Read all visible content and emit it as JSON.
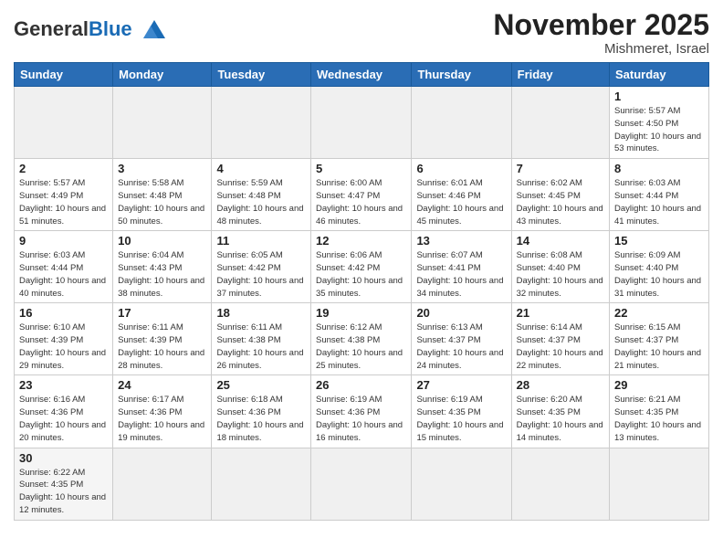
{
  "logo": {
    "text_general": "General",
    "text_blue": "Blue"
  },
  "header": {
    "month_title": "November 2025",
    "subtitle": "Mishmeret, Israel"
  },
  "weekdays": [
    "Sunday",
    "Monday",
    "Tuesday",
    "Wednesday",
    "Thursday",
    "Friday",
    "Saturday"
  ],
  "weeks": [
    [
      {
        "day": "",
        "empty": true
      },
      {
        "day": "",
        "empty": true
      },
      {
        "day": "",
        "empty": true
      },
      {
        "day": "",
        "empty": true
      },
      {
        "day": "",
        "empty": true
      },
      {
        "day": "",
        "empty": true
      },
      {
        "day": "1",
        "sunrise": "5:57 AM",
        "sunset": "4:50 PM",
        "daylight": "10 hours and 53 minutes."
      }
    ],
    [
      {
        "day": "2",
        "sunrise": "5:57 AM",
        "sunset": "4:49 PM",
        "daylight": "10 hours and 51 minutes."
      },
      {
        "day": "3",
        "sunrise": "5:58 AM",
        "sunset": "4:48 PM",
        "daylight": "10 hours and 50 minutes."
      },
      {
        "day": "4",
        "sunrise": "5:59 AM",
        "sunset": "4:48 PM",
        "daylight": "10 hours and 48 minutes."
      },
      {
        "day": "5",
        "sunrise": "6:00 AM",
        "sunset": "4:47 PM",
        "daylight": "10 hours and 46 minutes."
      },
      {
        "day": "6",
        "sunrise": "6:01 AM",
        "sunset": "4:46 PM",
        "daylight": "10 hours and 45 minutes."
      },
      {
        "day": "7",
        "sunrise": "6:02 AM",
        "sunset": "4:45 PM",
        "daylight": "10 hours and 43 minutes."
      },
      {
        "day": "8",
        "sunrise": "6:03 AM",
        "sunset": "4:44 PM",
        "daylight": "10 hours and 41 minutes."
      }
    ],
    [
      {
        "day": "9",
        "sunrise": "6:03 AM",
        "sunset": "4:44 PM",
        "daylight": "10 hours and 40 minutes."
      },
      {
        "day": "10",
        "sunrise": "6:04 AM",
        "sunset": "4:43 PM",
        "daylight": "10 hours and 38 minutes."
      },
      {
        "day": "11",
        "sunrise": "6:05 AM",
        "sunset": "4:42 PM",
        "daylight": "10 hours and 37 minutes."
      },
      {
        "day": "12",
        "sunrise": "6:06 AM",
        "sunset": "4:42 PM",
        "daylight": "10 hours and 35 minutes."
      },
      {
        "day": "13",
        "sunrise": "6:07 AM",
        "sunset": "4:41 PM",
        "daylight": "10 hours and 34 minutes."
      },
      {
        "day": "14",
        "sunrise": "6:08 AM",
        "sunset": "4:40 PM",
        "daylight": "10 hours and 32 minutes."
      },
      {
        "day": "15",
        "sunrise": "6:09 AM",
        "sunset": "4:40 PM",
        "daylight": "10 hours and 31 minutes."
      }
    ],
    [
      {
        "day": "16",
        "sunrise": "6:10 AM",
        "sunset": "4:39 PM",
        "daylight": "10 hours and 29 minutes."
      },
      {
        "day": "17",
        "sunrise": "6:11 AM",
        "sunset": "4:39 PM",
        "daylight": "10 hours and 28 minutes."
      },
      {
        "day": "18",
        "sunrise": "6:11 AM",
        "sunset": "4:38 PM",
        "daylight": "10 hours and 26 minutes."
      },
      {
        "day": "19",
        "sunrise": "6:12 AM",
        "sunset": "4:38 PM",
        "daylight": "10 hours and 25 minutes."
      },
      {
        "day": "20",
        "sunrise": "6:13 AM",
        "sunset": "4:37 PM",
        "daylight": "10 hours and 24 minutes."
      },
      {
        "day": "21",
        "sunrise": "6:14 AM",
        "sunset": "4:37 PM",
        "daylight": "10 hours and 22 minutes."
      },
      {
        "day": "22",
        "sunrise": "6:15 AM",
        "sunset": "4:37 PM",
        "daylight": "10 hours and 21 minutes."
      }
    ],
    [
      {
        "day": "23",
        "sunrise": "6:16 AM",
        "sunset": "4:36 PM",
        "daylight": "10 hours and 20 minutes."
      },
      {
        "day": "24",
        "sunrise": "6:17 AM",
        "sunset": "4:36 PM",
        "daylight": "10 hours and 19 minutes."
      },
      {
        "day": "25",
        "sunrise": "6:18 AM",
        "sunset": "4:36 PM",
        "daylight": "10 hours and 18 minutes."
      },
      {
        "day": "26",
        "sunrise": "6:19 AM",
        "sunset": "4:36 PM",
        "daylight": "10 hours and 16 minutes."
      },
      {
        "day": "27",
        "sunrise": "6:19 AM",
        "sunset": "4:35 PM",
        "daylight": "10 hours and 15 minutes."
      },
      {
        "day": "28",
        "sunrise": "6:20 AM",
        "sunset": "4:35 PM",
        "daylight": "10 hours and 14 minutes."
      },
      {
        "day": "29",
        "sunrise": "6:21 AM",
        "sunset": "4:35 PM",
        "daylight": "10 hours and 13 minutes."
      }
    ],
    [
      {
        "day": "30",
        "sunrise": "6:22 AM",
        "sunset": "4:35 PM",
        "daylight": "10 hours and 12 minutes."
      },
      {
        "day": "",
        "empty": true
      },
      {
        "day": "",
        "empty": true
      },
      {
        "day": "",
        "empty": true
      },
      {
        "day": "",
        "empty": true
      },
      {
        "day": "",
        "empty": true
      },
      {
        "day": "",
        "empty": true
      }
    ]
  ],
  "labels": {
    "sunrise": "Sunrise: ",
    "sunset": "Sunset: ",
    "daylight": "Daylight: "
  }
}
